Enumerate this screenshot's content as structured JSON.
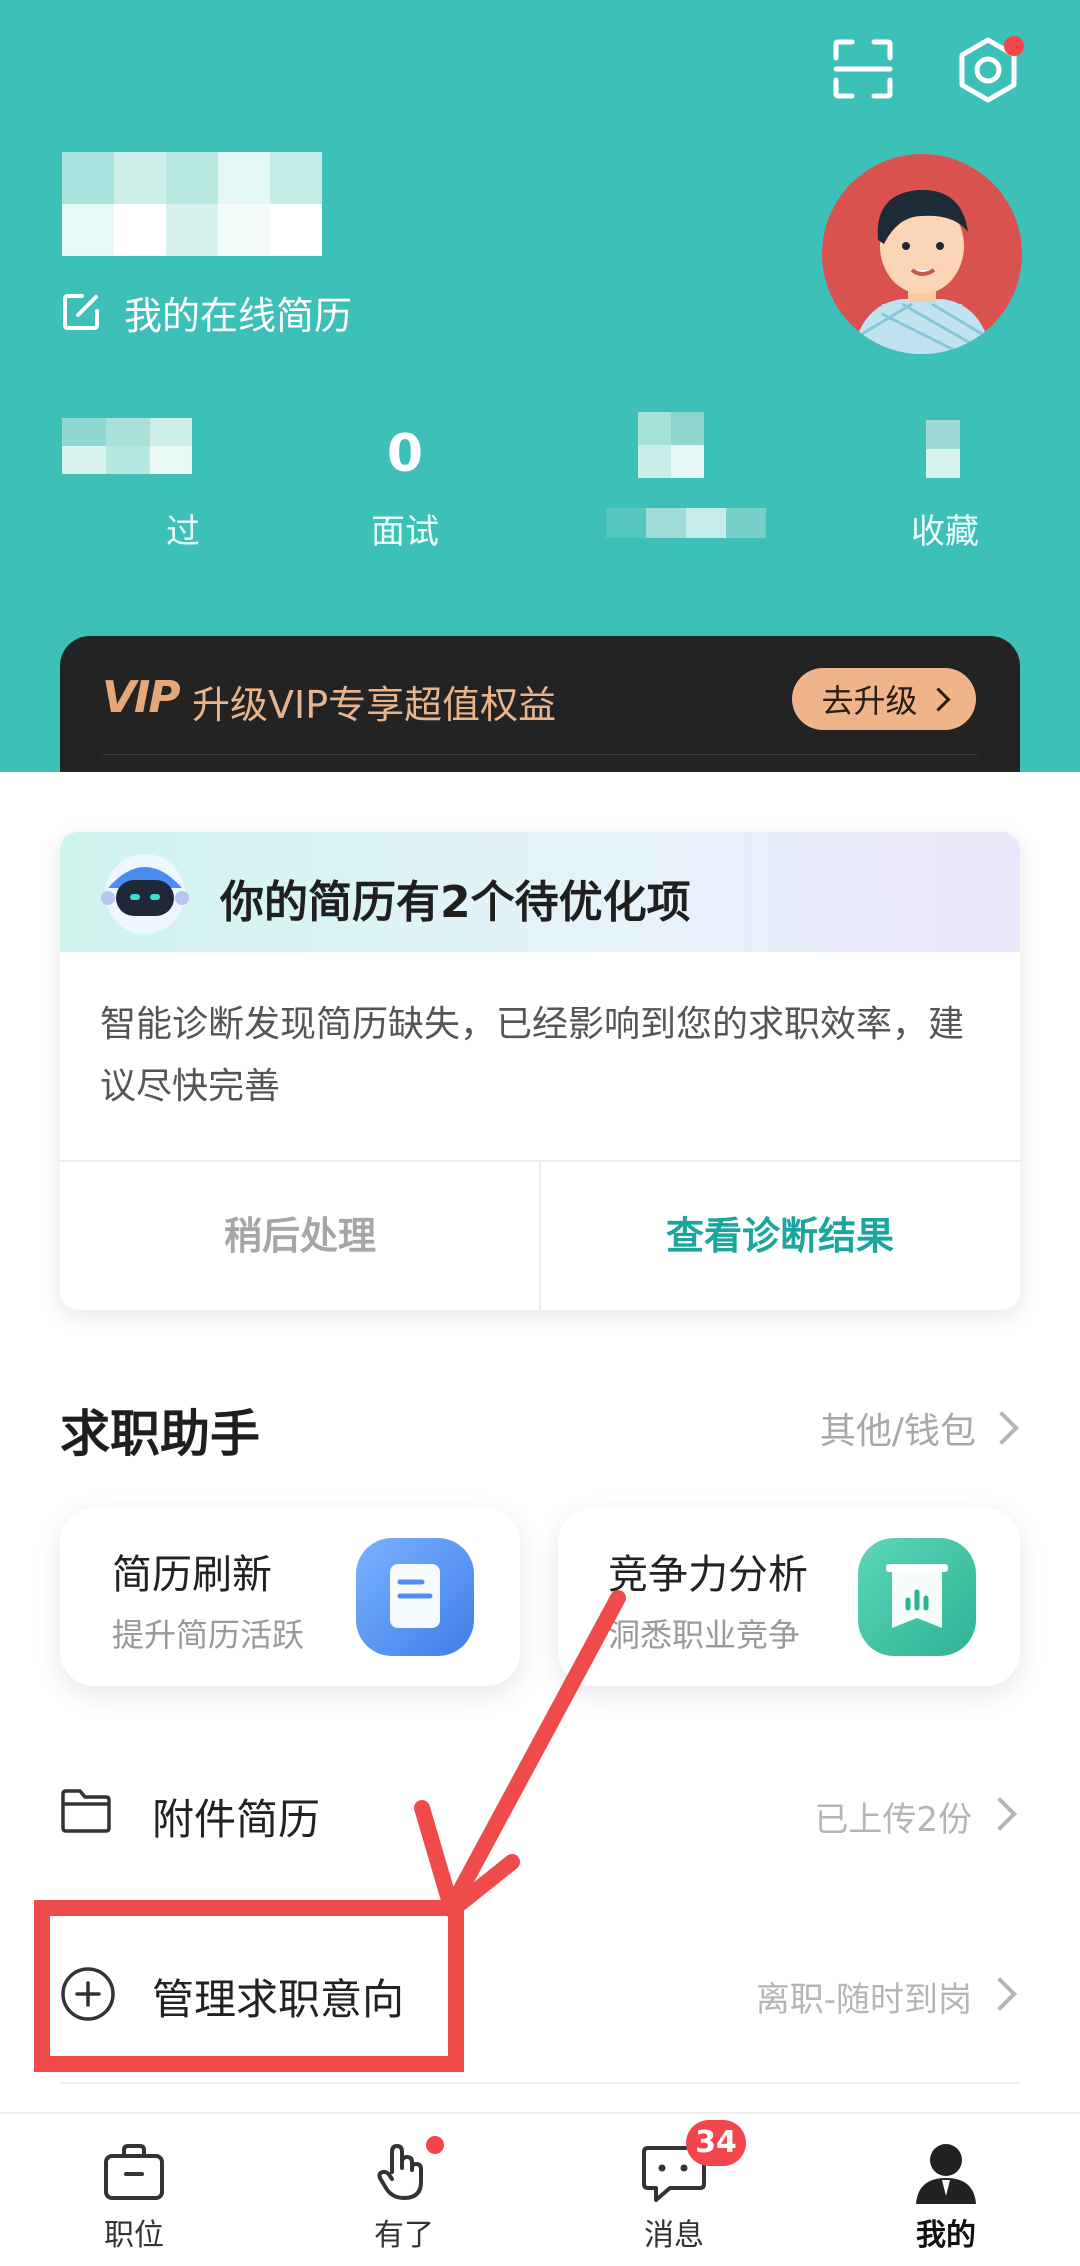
{
  "header": {
    "online_resume_label": "我的在线简历",
    "stats": [
      {
        "value": "",
        "label": "过"
      },
      {
        "value": "0",
        "label": "面试"
      },
      {
        "value": "",
        "label": ""
      },
      {
        "value": "",
        "label": "收藏"
      }
    ]
  },
  "vip": {
    "logo": "VIP",
    "text": "升级VIP专享超值权益",
    "button": "去升级"
  },
  "diagnosis": {
    "title": "你的简历有2个待优化项",
    "body": "智能诊断发现简历缺失，已经影响到您的求职效率，建议尽快完善",
    "later_button": "稍后处理",
    "view_button": "查看诊断结果"
  },
  "assistant": {
    "title": "求职助手",
    "more_link": "其他/钱包",
    "cards": [
      {
        "title": "简历刷新",
        "subtitle": "提升简历活跃",
        "icon": "document-icon"
      },
      {
        "title": "竞争力分析",
        "subtitle": "洞悉职业竞争",
        "icon": "chart-board-icon"
      }
    ]
  },
  "list": [
    {
      "title": "附件简历",
      "value": "已上传2份",
      "icon": "folder-icon"
    },
    {
      "title": "管理求职意向",
      "value": "离职-随时到岗",
      "icon": "plus-circle-icon"
    }
  ],
  "tabbar": {
    "items": [
      {
        "label": "职位",
        "icon": "briefcase-icon"
      },
      {
        "label": "有了",
        "icon": "hand-icon"
      },
      {
        "label": "消息",
        "icon": "chat-icon",
        "badge": "34"
      },
      {
        "label": "我的",
        "icon": "person-icon"
      }
    ]
  },
  "colors": {
    "teal": "#3cc0b8",
    "accent_text": "#1aa59e",
    "annotation_red": "#ef4b4b",
    "vip_gold": "#f0b587",
    "badge_red": "#f3454b"
  }
}
